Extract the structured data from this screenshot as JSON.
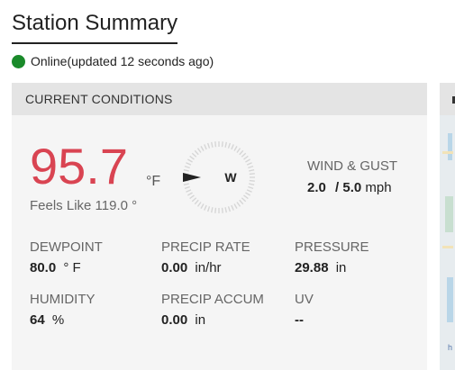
{
  "page": {
    "title": "Station Summary",
    "status": {
      "text": "Online(updated 12 seconds ago)",
      "color": "#1a8a2a",
      "icon": "status-dot-icon"
    }
  },
  "current_conditions": {
    "header": "CURRENT CONDITIONS",
    "temperature": {
      "value": "95.7",
      "unit": "°F",
      "color": "#d94452"
    },
    "feels_like": "Feels Like 119.0 °",
    "wind": {
      "direction": "W",
      "label": "WIND & GUST",
      "speed": "2.0",
      "separator": "/",
      "gust": "5.0",
      "unit": "mph"
    },
    "metrics": {
      "dewpoint": {
        "label": "DEWPOINT",
        "value": "80.0",
        "unit": "° F"
      },
      "precip_rate": {
        "label": "PRECIP RATE",
        "value": "0.00",
        "unit": "in/hr"
      },
      "pressure": {
        "label": "PRESSURE",
        "value": "29.88",
        "unit": "in"
      },
      "humidity": {
        "label": "HUMIDITY",
        "value": "64",
        "unit": "%"
      },
      "precip_accum": {
        "label": "PRECIP ACCUM",
        "value": "0.00",
        "unit": "in"
      },
      "uv": {
        "label": "UV",
        "value": "--",
        "unit": ""
      }
    }
  },
  "side_panel": {
    "map_text": "h"
  }
}
